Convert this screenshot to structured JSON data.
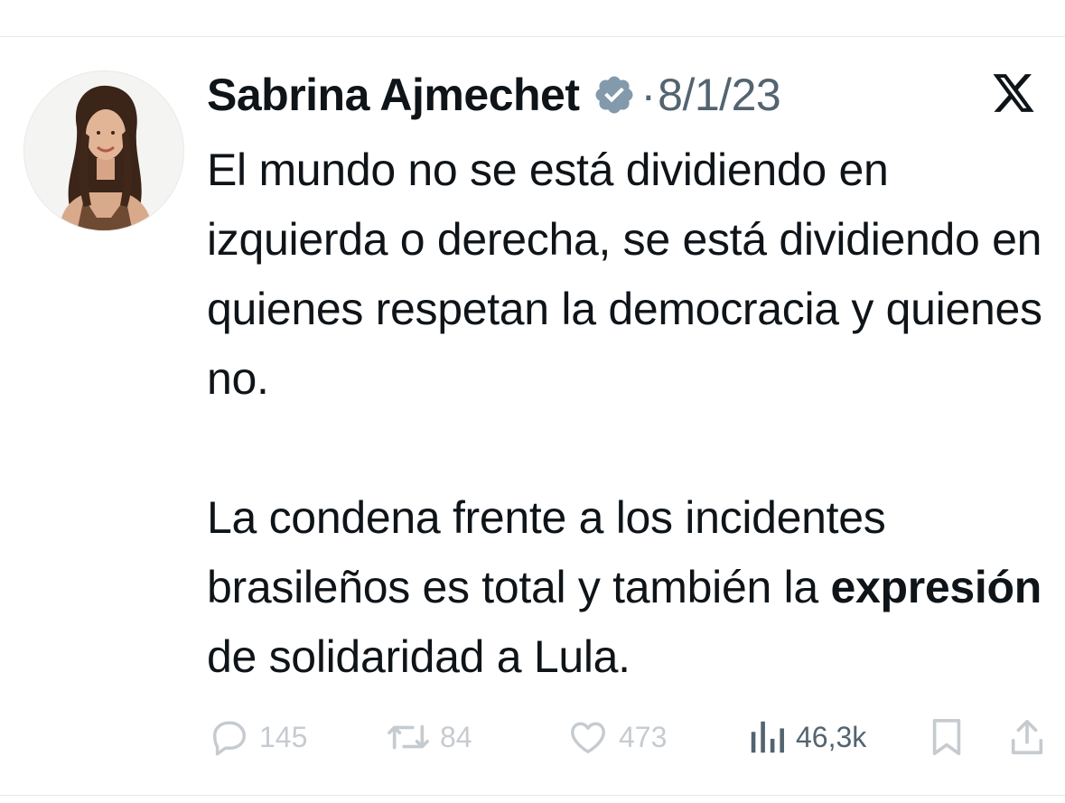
{
  "tweet": {
    "author": {
      "name": "Sabrina Ajmechet",
      "verified": true,
      "avatar_icon": "profile-photo"
    },
    "separator": "·",
    "date": "8/1/23",
    "platform_icon": "x-logo-icon",
    "text": {
      "paragraph1": "El mundo no se está dividiendo en izquierda o derecha, se está dividiendo en quienes respetan la democracia y quienes no.",
      "paragraph2_part1": "La condena frente a los incidentes brasileños es total y también la ",
      "paragraph2_bold": "expresión",
      "paragraph2_part2": " de solidaridad a Lula."
    },
    "stats": {
      "replies": "145",
      "retweets": "84",
      "likes": "473",
      "views": "46,3k"
    }
  },
  "colors": {
    "text": "#0f1419",
    "secondary": "#536471",
    "muted_icons": "#c6cbd0",
    "verified_badge": "#829aab"
  }
}
